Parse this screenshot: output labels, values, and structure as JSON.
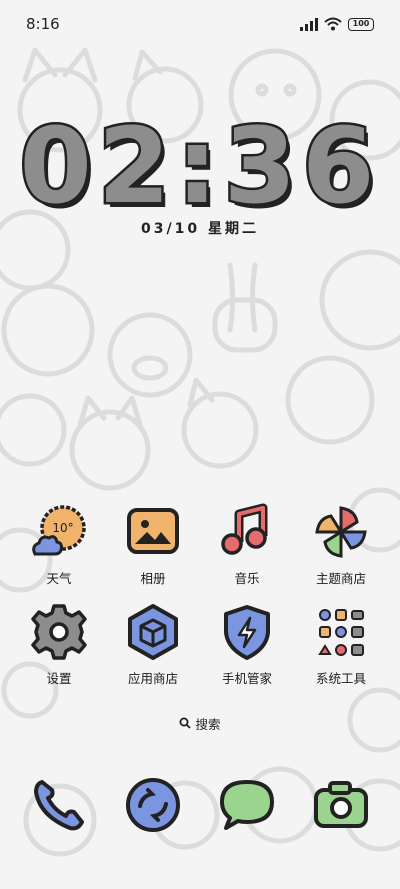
{
  "status_bar": {
    "time": "8:16",
    "battery": "100"
  },
  "lockclock": {
    "time": "02:36",
    "date": "03/10  星期二"
  },
  "weather": {
    "temp": "10°"
  },
  "apps": [
    {
      "label": "天气",
      "icon": "weather-icon"
    },
    {
      "label": "相册",
      "icon": "gallery-icon"
    },
    {
      "label": "音乐",
      "icon": "music-icon"
    },
    {
      "label": "主题商店",
      "icon": "theme-store-icon"
    },
    {
      "label": "设置",
      "icon": "settings-icon"
    },
    {
      "label": "应用商店",
      "icon": "app-store-icon"
    },
    {
      "label": "手机管家",
      "icon": "security-icon"
    },
    {
      "label": "系统工具",
      "icon": "system-tools-folder-icon"
    }
  ],
  "search": {
    "label": "搜索"
  },
  "dock": [
    {
      "icon": "phone-icon"
    },
    {
      "icon": "browser-icon"
    },
    {
      "icon": "messages-icon"
    },
    {
      "icon": "camera-icon"
    }
  ],
  "colors": {
    "background": "#f4f4f4",
    "outline": "#222222",
    "clock_fill": "#8d8d8d",
    "blue": "#7b95e0",
    "orange": "#f0b36c",
    "red": "#e46c6c",
    "green": "#9bd48f"
  }
}
